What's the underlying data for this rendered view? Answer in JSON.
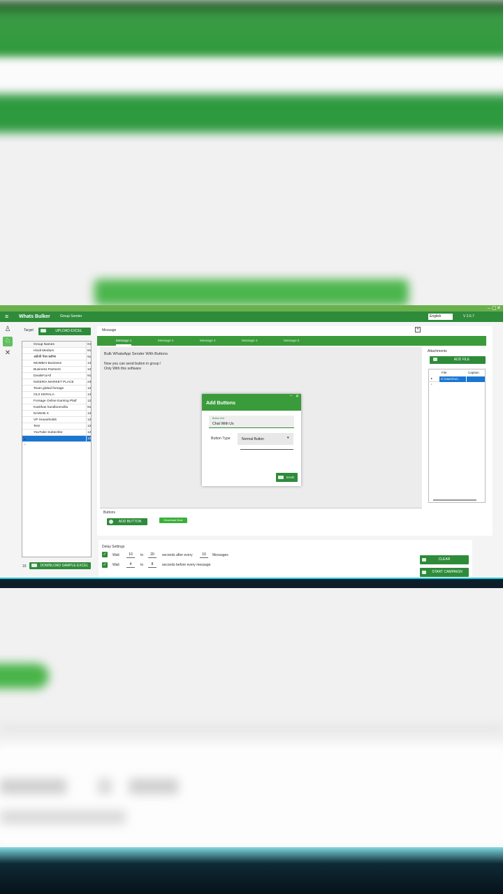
{
  "app": {
    "title": "Whats Bulker",
    "subtitle": "Group Sender",
    "language": "English",
    "version": "V 2.6.7",
    "accent": "#2e8b3a"
  },
  "sidebar": {
    "items": [
      {
        "icon": "user-icon"
      },
      {
        "icon": "group-icon"
      },
      {
        "icon": "tools-icon"
      }
    ]
  },
  "target": {
    "label": "Target",
    "upload_label": "UPLOAD EXCEL",
    "columns": [
      "Group Names",
      "Gr"
    ],
    "rows": [
      {
        "name": "Hindi Medium",
        "id": "91"
      },
      {
        "name": "अंग्रेजी ऐप्स ब्लॉग्स",
        "id": "91"
      },
      {
        "name": "MUMBAI Business",
        "id": "12"
      },
      {
        "name": "Business Partners",
        "id": "12"
      },
      {
        "name": "DealsForAll",
        "id": "91"
      },
      {
        "name": "NIGERIA MARKET PLACE",
        "id": "23"
      },
      {
        "name": "Team global forsage",
        "id": "12"
      },
      {
        "name": "OLX KERALA",
        "id": "12"
      },
      {
        "name": "Forsage Online Earning Platf",
        "id": "12"
      },
      {
        "name": "Kavithas handloomvilla",
        "id": "91"
      },
      {
        "name": "NAWAB X",
        "id": "12"
      },
      {
        "name": "VP Households",
        "id": "12"
      },
      {
        "name": "Test",
        "id": "12"
      },
      {
        "name": "YouTube Subscribe",
        "id": "12"
      },
      {
        "name": "",
        "id": "12"
      }
    ],
    "count": "15",
    "download_label": "DOWNLOAD SAMPLE EXCEL"
  },
  "message": {
    "label": "Message",
    "tabs": [
      "Message 1",
      "Message 2",
      "Message 3",
      "Message 4",
      "Message 5"
    ],
    "active_tab": 0,
    "body_line1": "Bulk WhatsApp Sender With Buttons",
    "body_line2": "Now you can send button in group !",
    "body_line3": "Only With this software"
  },
  "dialog": {
    "title": "Add Buttons",
    "field_label": "Button text",
    "field_value": "Chat With Us",
    "type_label": "Button Type",
    "type_value": "Normal Button",
    "save_label": "SAVE"
  },
  "buttons_section": {
    "label": "Buttons",
    "add_label": "ADD BUTTON",
    "download_label": "Download Now"
  },
  "attachments": {
    "label": "Attachments",
    "add_label": "ADD FILE",
    "columns": [
      "File",
      "Caption"
    ],
    "rows": [
      {
        "file": "C:\\Users\\Ad...",
        "caption": ""
      }
    ]
  },
  "delay": {
    "label": "Delay Settings",
    "row1": {
      "wait": "Wait",
      "from": "10",
      "to_word": "to",
      "to": "20",
      "text": "seconds after every",
      "count": "10",
      "unit": "Messages"
    },
    "row2": {
      "wait": "Wait",
      "from": "4",
      "to_word": "to",
      "to": "8",
      "text": "seconds before every message"
    },
    "clear_label": "CLEAR",
    "start_label": "START CAMPAIGN"
  }
}
